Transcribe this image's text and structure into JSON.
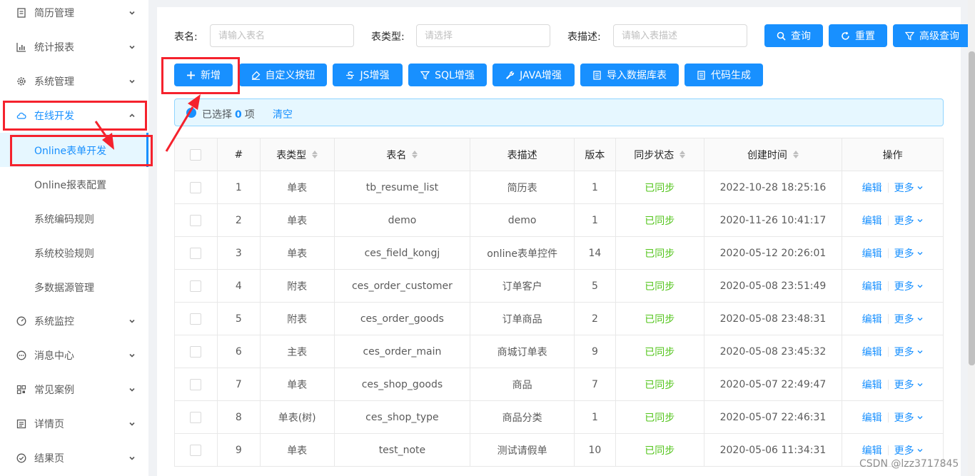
{
  "sidebar": {
    "items": [
      {
        "label": "简历管理",
        "icon": "resume-icon"
      },
      {
        "label": "统计报表",
        "icon": "bar-chart-icon"
      },
      {
        "label": "系统管理",
        "icon": "gear-icon"
      },
      {
        "label": "在线开发",
        "icon": "cloud-icon"
      },
      {
        "label": "系统监控",
        "icon": "dashboard-icon"
      },
      {
        "label": "消息中心",
        "icon": "message-icon"
      },
      {
        "label": "常见案例",
        "icon": "qrcode-icon"
      },
      {
        "label": "详情页",
        "icon": "profile-icon"
      },
      {
        "label": "结果页",
        "icon": "check-circle-icon"
      }
    ],
    "sub_items": [
      "Online表单开发",
      "Online报表配置",
      "系统编码规则",
      "系统校验规则",
      "多数据源管理"
    ]
  },
  "search": {
    "table_name_label": "表名:",
    "table_name_placeholder": "请输入表名",
    "table_type_label": "表类型:",
    "table_type_placeholder": "请选择",
    "table_desc_label": "表描述:",
    "table_desc_placeholder": "请输入表描述",
    "query_label": "查询",
    "reset_label": "重置",
    "advanced_label": "高级查询"
  },
  "toolbar": {
    "add_label": "新增",
    "custom_button_label": "自定义按钮",
    "js_label": "JS增强",
    "sql_label": "SQL增强",
    "java_label": "JAVA增强",
    "import_label": "导入数据库表",
    "codegen_label": "代码生成"
  },
  "alert": {
    "prefix": "已选择",
    "count": "0",
    "suffix": "项",
    "clear_label": "清空"
  },
  "table": {
    "headers": [
      "#",
      "表类型",
      "表名",
      "表描述",
      "版本",
      "同步状态",
      "创建时间",
      "操作"
    ],
    "rows": [
      {
        "no": "1",
        "type": "单表",
        "name": "tb_resume_list",
        "desc": "简历表",
        "version": "1",
        "status": "已同步",
        "created": "2022-10-28 18:25:16"
      },
      {
        "no": "2",
        "type": "单表",
        "name": "demo",
        "desc": "demo",
        "version": "1",
        "status": "已同步",
        "created": "2020-11-26 10:41:17"
      },
      {
        "no": "3",
        "type": "单表",
        "name": "ces_field_kongj",
        "desc": "online表单控件",
        "version": "14",
        "status": "已同步",
        "created": "2020-05-12 20:26:01"
      },
      {
        "no": "4",
        "type": "附表",
        "name": "ces_order_customer",
        "desc": "订单客户",
        "version": "5",
        "status": "已同步",
        "created": "2020-05-08 23:51:49"
      },
      {
        "no": "5",
        "type": "附表",
        "name": "ces_order_goods",
        "desc": "订单商品",
        "version": "2",
        "status": "已同步",
        "created": "2020-05-08 23:48:31"
      },
      {
        "no": "6",
        "type": "主表",
        "name": "ces_order_main",
        "desc": "商城订单表",
        "version": "9",
        "status": "已同步",
        "created": "2020-05-08 23:45:32"
      },
      {
        "no": "7",
        "type": "单表",
        "name": "ces_shop_goods",
        "desc": "商品",
        "version": "7",
        "status": "已同步",
        "created": "2020-05-07 22:49:47"
      },
      {
        "no": "8",
        "type": "单表(树)",
        "name": "ces_shop_type",
        "desc": "商品分类",
        "version": "1",
        "status": "已同步",
        "created": "2020-05-07 22:46:31"
      },
      {
        "no": "9",
        "type": "单表",
        "name": "test_note",
        "desc": "测试请假单",
        "version": "10",
        "status": "已同步",
        "created": "2020-05-06 11:34:31"
      }
    ],
    "edit_label": "编辑",
    "more_label": "更多"
  },
  "watermark": "CSDN @lzz3717845",
  "colors": {
    "primary": "#1890ff",
    "success": "#52c41a",
    "annotation": "#f5222d"
  }
}
